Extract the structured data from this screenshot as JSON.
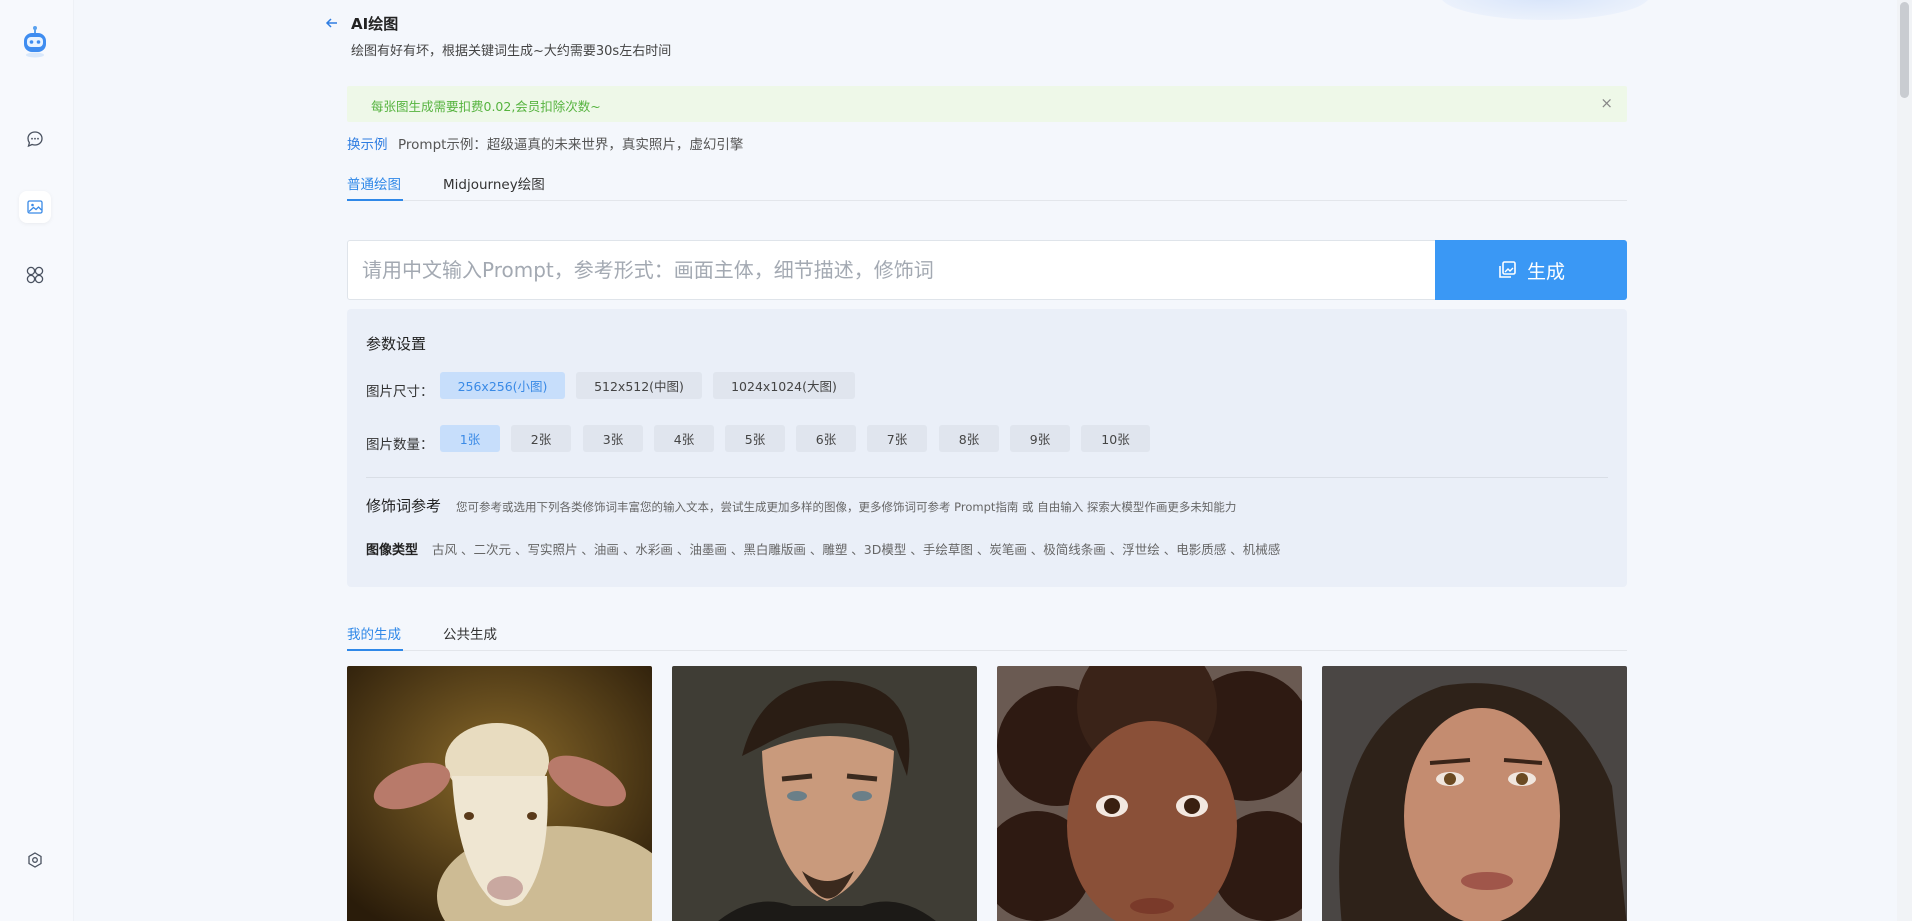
{
  "header": {
    "title": "AI绘图",
    "subtitle": "绘图有好有坏，根据关键词生成~大约需要30s左右时间"
  },
  "alert": {
    "text": "每张图生成需要扣费0.02,会员扣除次数~",
    "close": "×"
  },
  "example": {
    "link": "换示例",
    "text": "Prompt示例：超级逼真的未来世界，真实照片，虚幻引擎"
  },
  "mode_tabs": [
    {
      "label": "普通绘图",
      "active": true
    },
    {
      "label": "Midjourney绘图",
      "active": false
    }
  ],
  "prompt": {
    "placeholder": "请用中文输入Prompt，参考形式：画面主体，细节描述，修饰词",
    "value": "",
    "button": "生成"
  },
  "params": {
    "title": "参数设置",
    "size_label": "图片尺寸：",
    "sizes": [
      "256x256(小图)",
      "512x512(中图)",
      "1024x1024(大图)"
    ],
    "selected_size": "256x256(小图)",
    "count_label": "图片数量：",
    "counts": [
      "1张",
      "2张",
      "3张",
      "4张",
      "5张",
      "6张",
      "7张",
      "8张",
      "9张",
      "10张"
    ],
    "selected_count": "1张",
    "modifier_title": "修饰词参考",
    "modifier_desc": "您可参考或选用下列各类修饰词丰富您的输入文本，尝试生成更加多样的图像，更多修饰词可参考 Prompt指南 或 自由输入 探索大模型作画更多未知能力",
    "type_label": "图像类型",
    "types": "古风 、二次元 、写实照片 、油画 、水彩画 、油墨画 、黑白雕版画 、雕塑 、3D模型 、手绘草图 、炭笔画 、极简线条画 、浮世绘 、电影质感 、机械感"
  },
  "gallery_tabs": [
    {
      "label": "我的生成",
      "active": true
    },
    {
      "label": "公共生成",
      "active": false
    }
  ],
  "gallery": [
    "sheep",
    "man-portrait",
    "child-portrait",
    "woman-portrait"
  ],
  "colors": {
    "accent": "#3a98f5",
    "alert_bg": "#eef8e8",
    "alert_text": "#56b33f",
    "panel_bg": "#eaeff8"
  }
}
